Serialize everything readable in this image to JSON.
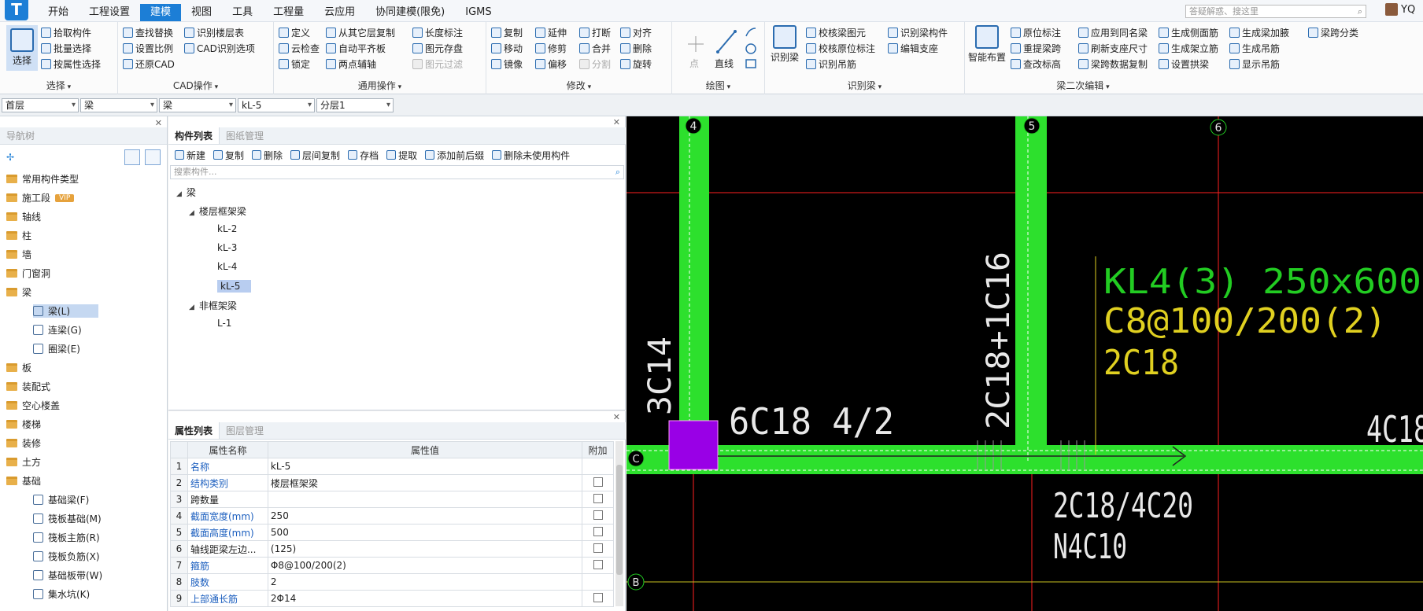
{
  "menu": {
    "tabs": [
      "开始",
      "工程设置",
      "建模",
      "视图",
      "工具",
      "工程量",
      "云应用",
      "协同建模(限免)",
      "IGMS"
    ],
    "active_tab": "建模",
    "search_placeholder": "答疑解惑、搜这里",
    "user": "YQ"
  },
  "ribbon": {
    "select": {
      "big": "选择",
      "label": "选择",
      "items": [
        "拾取构件",
        "批量选择",
        "按属性选择"
      ]
    },
    "cad": {
      "label": "CAD操作",
      "col1": [
        "查找替换",
        "设置比例",
        "还原CAD"
      ],
      "col2": [
        "识别楼层表",
        "CAD识别选项"
      ]
    },
    "general": {
      "label": "通用操作",
      "col1": [
        "定义",
        "云检查",
        "锁定"
      ],
      "col2": [
        "从其它层复制",
        "自动平齐板",
        "两点辅轴"
      ],
      "col3": [
        "长度标注",
        "图元存盘",
        "图元过滤"
      ]
    },
    "modify": {
      "label": "修改",
      "col1": [
        "复制",
        "移动",
        "镜像"
      ],
      "col2": [
        "延伸",
        "修剪",
        "偏移"
      ],
      "col3": [
        "打断",
        "合并",
        "分割"
      ],
      "col4": [
        "对齐",
        "删除",
        "旋转"
      ]
    },
    "draw": {
      "label": "绘图",
      "items": [
        "点",
        "直线"
      ]
    },
    "identify": {
      "label": "识别梁",
      "big": "识别梁",
      "col1": [
        "校核梁图元",
        "校核原位标注",
        "识别吊筋"
      ],
      "col2": [
        "识别梁构件",
        "编辑支座"
      ]
    },
    "secondary": {
      "label": "梁二次编辑",
      "big": "智能布置",
      "col1": [
        "原位标注",
        "重提梁跨",
        "查改标高"
      ],
      "col2": [
        "应用到同名梁",
        "刷新支座尺寸",
        "梁跨数据复制"
      ],
      "col3": [
        "生成侧面筋",
        "生成架立筋",
        "设置拱梁"
      ],
      "col4": [
        "生成梁加腋",
        "生成吊筋",
        "显示吊筋"
      ],
      "col5": [
        "梁跨分类"
      ]
    }
  },
  "filters": [
    "首层",
    "梁",
    "梁",
    "kL-5",
    "分层1"
  ],
  "nav": {
    "title": "导航树",
    "items": [
      {
        "label": "常用构件类型",
        "type": "folder"
      },
      {
        "label": "施工段",
        "type": "folder",
        "badge": "VIP"
      },
      {
        "label": "轴线",
        "type": "folder"
      },
      {
        "label": "柱",
        "type": "folder"
      },
      {
        "label": "墙",
        "type": "folder"
      },
      {
        "label": "门窗洞",
        "type": "folder"
      },
      {
        "label": "梁",
        "type": "folder"
      },
      {
        "label": "梁(L)",
        "type": "child",
        "selected": true
      },
      {
        "label": "连梁(G)",
        "type": "child"
      },
      {
        "label": "圈梁(E)",
        "type": "child"
      },
      {
        "label": "板",
        "type": "folder"
      },
      {
        "label": "装配式",
        "type": "folder"
      },
      {
        "label": "空心楼盖",
        "type": "folder"
      },
      {
        "label": "楼梯",
        "type": "folder"
      },
      {
        "label": "装修",
        "type": "folder"
      },
      {
        "label": "土方",
        "type": "folder"
      },
      {
        "label": "基础",
        "type": "folder"
      },
      {
        "label": "基础梁(F)",
        "type": "child"
      },
      {
        "label": "筏板基础(M)",
        "type": "child"
      },
      {
        "label": "筏板主筋(R)",
        "type": "child"
      },
      {
        "label": "筏板负筋(X)",
        "type": "child"
      },
      {
        "label": "基础板带(W)",
        "type": "child"
      },
      {
        "label": "集水坑(K)",
        "type": "child"
      }
    ]
  },
  "components": {
    "tabs": [
      "构件列表",
      "图纸管理"
    ],
    "toolbar": [
      "新建",
      "复制",
      "删除",
      "层间复制",
      "存档",
      "提取",
      "添加前后缀",
      "删除未使用构件"
    ],
    "search_placeholder": "搜索构件...",
    "tree": {
      "root": "梁",
      "group1": "楼层框架梁",
      "group1_items": [
        "kL-2",
        "kL-3",
        "kL-4",
        "kL-5"
      ],
      "selected": "kL-5",
      "group2": "非框架梁",
      "group2_items": [
        "L-1"
      ]
    }
  },
  "properties": {
    "tabs": [
      "属性列表",
      "图层管理"
    ],
    "headers": [
      "属性名称",
      "属性值",
      "附加"
    ],
    "rows": [
      {
        "n": "1",
        "name": "名称",
        "value": "kL-5",
        "blue": true,
        "check": false
      },
      {
        "n": "2",
        "name": "结构类别",
        "value": "楼层框架梁",
        "blue": true,
        "check": true
      },
      {
        "n": "3",
        "name": "跨数量",
        "value": "",
        "blue": false,
        "check": true
      },
      {
        "n": "4",
        "name": "截面宽度(mm)",
        "value": "250",
        "blue": true,
        "check": true
      },
      {
        "n": "5",
        "name": "截面高度(mm)",
        "value": "500",
        "blue": true,
        "check": true
      },
      {
        "n": "6",
        "name": "轴线距梁左边...",
        "value": "(125)",
        "blue": false,
        "check": true
      },
      {
        "n": "7",
        "name": "箍筋",
        "value": "Φ8@100/200(2)",
        "blue": true,
        "check": true
      },
      {
        "n": "8",
        "name": "肢数",
        "value": "2",
        "blue": true,
        "check": false
      },
      {
        "n": "9",
        "name": "上部通长筋",
        "value": "2Φ14",
        "blue": true,
        "check": true
      }
    ]
  },
  "canvas": {
    "axes": {
      "v": [
        "4",
        "5",
        "6"
      ],
      "h": [
        "C",
        "B"
      ]
    },
    "texts": {
      "kl4_name": "KL4(3) 250x600",
      "kl4_stirrup": "C8@100/200(2)",
      "kl4_top": "2C18",
      "col_left": "3C14",
      "bottom_bar": "6C18 4/2",
      "col_mid": "2C18+1C16",
      "right_bar": "4C18",
      "support": "2C18/4C20",
      "side": "N4C10"
    },
    "colors": {
      "beam": "#2de02d",
      "column": "#9900e6",
      "axis": "#ff2020",
      "label_green": "#22cc22",
      "label_yellow": "#e0d020",
      "text_white": "#e8e8e8"
    }
  }
}
